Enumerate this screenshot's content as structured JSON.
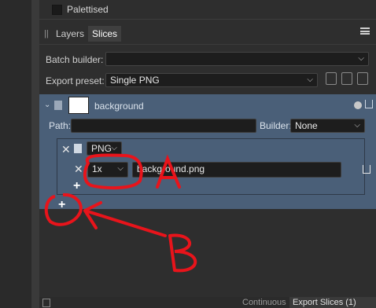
{
  "export_options": {
    "palettised_label": "Palettised"
  },
  "panel": {
    "tabs": [
      {
        "label": "Layers"
      },
      {
        "label": "Slices"
      }
    ],
    "batch_builder": {
      "label": "Batch builder:",
      "value": ""
    },
    "export_preset": {
      "label": "Export preset:",
      "value": "Single PNG"
    }
  },
  "slice": {
    "name": "background",
    "path_label": "Path:",
    "path_value": "",
    "builder_label": "Builder:",
    "builder_value": "None",
    "format": {
      "type": "PNG",
      "scale": "1x",
      "filename": "background.png"
    }
  },
  "footer": {
    "continuous_label": "Continuous",
    "export_label": "Export Slices (1)"
  },
  "annotations": {
    "label_a": "A",
    "label_b": "B",
    "color": "#e8141b"
  },
  "colors": {
    "selection_bg": "#4a5f78",
    "panel_bg": "#2e2e2e",
    "annotation_red": "#e8141b"
  }
}
